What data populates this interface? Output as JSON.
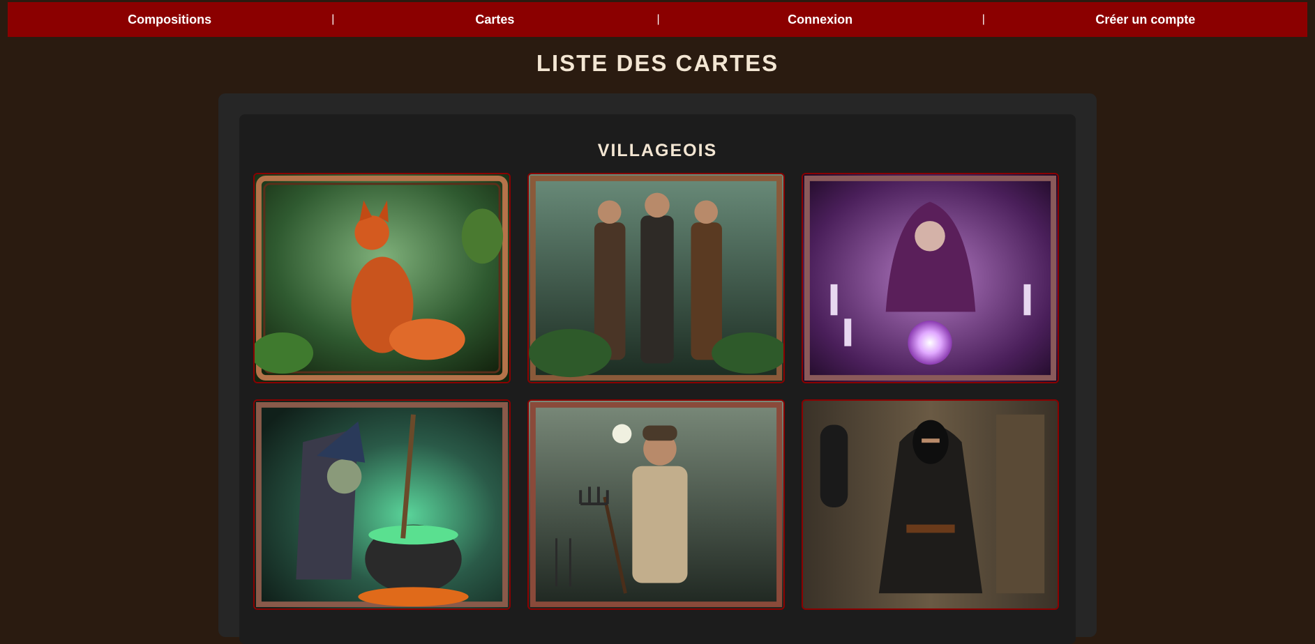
{
  "nav": {
    "items": [
      {
        "label": "Compositions"
      },
      {
        "label": "Cartes"
      },
      {
        "label": "Connexion"
      },
      {
        "label": "Créer un compte"
      }
    ],
    "separator": "|"
  },
  "page": {
    "title": "LISTE DES CARTES"
  },
  "sections": [
    {
      "title": "VILLAGEOIS",
      "cards": [
        {
          "art": "fox-in-forest",
          "accent": "#3d6b3a"
        },
        {
          "art": "three-hunters",
          "accent": "#2f4a3a"
        },
        {
          "art": "seer-crystal-ball",
          "accent": "#7a3a8c"
        },
        {
          "art": "witch-cauldron",
          "accent": "#2f6a4a"
        },
        {
          "art": "villager-pitchfork",
          "accent": "#3f4a3f"
        },
        {
          "art": "hooded-thief",
          "accent": "#4a3f2f"
        }
      ]
    }
  ],
  "colors": {
    "background": "#2a1b10",
    "navbar": "#8b0000",
    "card_border": "#8b0000",
    "title_text": "#f3e6d3"
  }
}
